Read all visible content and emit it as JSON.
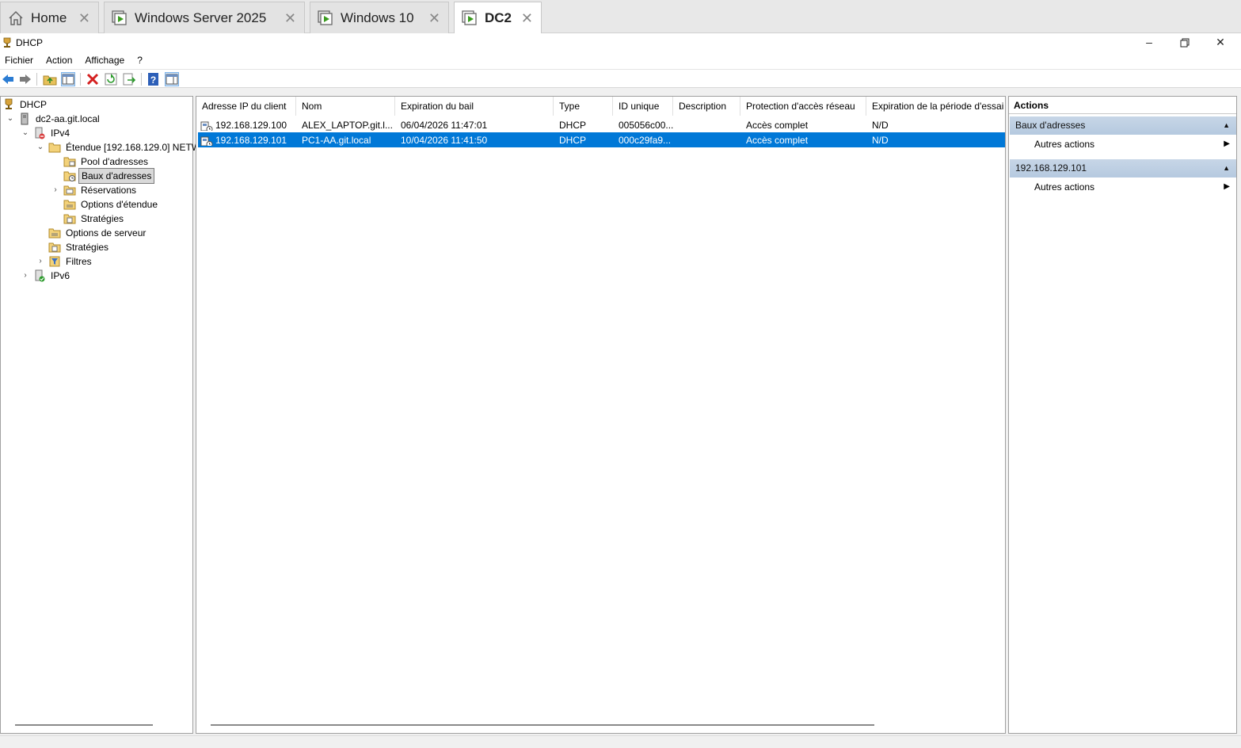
{
  "tabs": [
    {
      "label": "Home",
      "icon": "home-icon"
    },
    {
      "label": "Windows Server 2025",
      "icon": "vm-icon"
    },
    {
      "label": "Windows 10",
      "icon": "vm-icon"
    },
    {
      "label": "DC2",
      "icon": "vm-icon",
      "active": true
    }
  ],
  "window": {
    "title": "DHCP"
  },
  "menu": {
    "file": "Fichier",
    "action": "Action",
    "view": "Affichage",
    "help": "?"
  },
  "tree": {
    "root": "DHCP",
    "server": "dc2-aa.git.local",
    "ipv4": "IPv4",
    "scope": "Étendue [192.168.129.0] NETW",
    "pool": "Pool d'adresses",
    "leases": "Baux d'adresses",
    "reservations": "Réservations",
    "scope_options": "Options d'étendue",
    "scope_policies": "Stratégies",
    "server_options": "Options de serveur",
    "policies": "Stratégies",
    "filters": "Filtres",
    "ipv6": "IPv6"
  },
  "list": {
    "columns": [
      "Adresse IP du client",
      "Nom",
      "Expiration du bail",
      "Type",
      "ID unique",
      "Description",
      "Protection d'accès réseau",
      "Expiration de la période d'essai"
    ],
    "rows": [
      {
        "ip": "192.168.129.100",
        "name": "ALEX_LAPTOP.git.l...",
        "expiry": "06/04/2026 11:47:01",
        "type": "DHCP",
        "uid": "005056c00...",
        "desc": "",
        "nap": "Accès complet",
        "trial": "N/D"
      },
      {
        "ip": "192.168.129.101",
        "name": "PC1-AA.git.local",
        "expiry": "10/04/2026 11:41:50",
        "type": "DHCP",
        "uid": "000c29fa9...",
        "desc": "",
        "nap": "Accès complet",
        "trial": "N/D",
        "selected": true
      }
    ]
  },
  "actions": {
    "title": "Actions",
    "section1": "Baux d'adresses",
    "item1": "Autres actions",
    "section2": "192.168.129.101",
    "item2": "Autres actions"
  },
  "colors": {
    "selection": "#0078d7",
    "section": "#c0d1e4"
  }
}
